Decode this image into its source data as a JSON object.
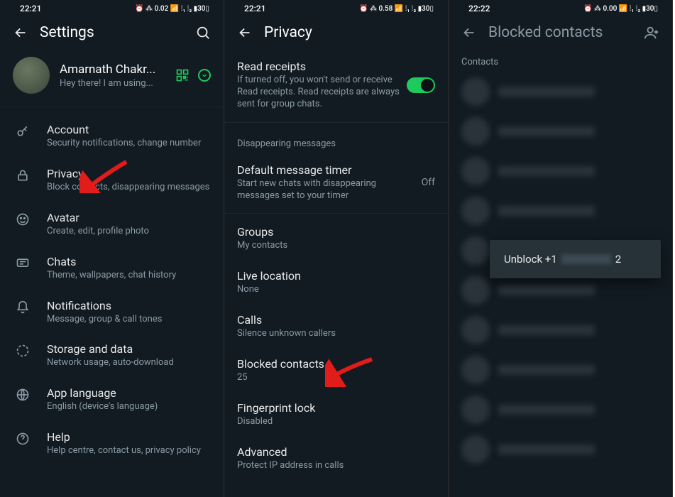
{
  "panel1": {
    "status_time": "22:21",
    "status_right": "⏰ ⁂ 0.02 📶 ⁞₁ ⁞₂ ▮30▯",
    "title": "Settings",
    "profile_name": "Amarnath Chakr...",
    "profile_status": "Hey there! I am using...",
    "items": [
      {
        "icon": "key-icon",
        "title": "Account",
        "sub": "Security notifications, change number"
      },
      {
        "icon": "lock-icon",
        "title": "Privacy",
        "sub": "Block contacts, disappearing messages"
      },
      {
        "icon": "face-icon",
        "title": "Avatar",
        "sub": "Create, edit, profile photo"
      },
      {
        "icon": "chat-icon",
        "title": "Chats",
        "sub": "Theme, wallpapers, chat history"
      },
      {
        "icon": "bell-icon",
        "title": "Notifications",
        "sub": "Message, group & call tones"
      },
      {
        "icon": "data-icon",
        "title": "Storage and data",
        "sub": "Network usage, auto-download"
      },
      {
        "icon": "globe-icon",
        "title": "App language",
        "sub": "English (device's language)"
      },
      {
        "icon": "help-icon",
        "title": "Help",
        "sub": "Help centre, contact us, privacy policy"
      }
    ]
  },
  "panel2": {
    "status_time": "22:21",
    "status_right": "⏰ ⁂ 0.58 📶 ⁞₁ ⁞₂ ▮30▯",
    "title": "Privacy",
    "read_receipts": {
      "title": "Read receipts",
      "sub": "If turned off, you won't send or receive Read receipts. Read receipts are always sent for group chats.",
      "on": true
    },
    "section_disappearing": "Disappearing messages",
    "default_timer": {
      "title": "Default message timer",
      "sub": "Start new chats with disappearing messages set to your timer",
      "value": "Off"
    },
    "groups": {
      "title": "Groups",
      "sub": "My contacts"
    },
    "live_location": {
      "title": "Live location",
      "sub": "None"
    },
    "calls": {
      "title": "Calls",
      "sub": "Silence unknown callers"
    },
    "blocked": {
      "title": "Blocked contacts",
      "sub": "25"
    },
    "fingerprint": {
      "title": "Fingerprint lock",
      "sub": "Disabled"
    },
    "advanced": {
      "title": "Advanced",
      "sub": "Protect IP address in calls"
    }
  },
  "panel3": {
    "status_time": "22:22",
    "status_right": "⏰ ⁂ 0.00 📶 ⁞₁ ⁞₂ ▮30▯",
    "title": "Blocked contacts",
    "contacts_label": "Contacts",
    "unblock_prefix": "Unblock +1",
    "unblock_suffix": "2"
  }
}
